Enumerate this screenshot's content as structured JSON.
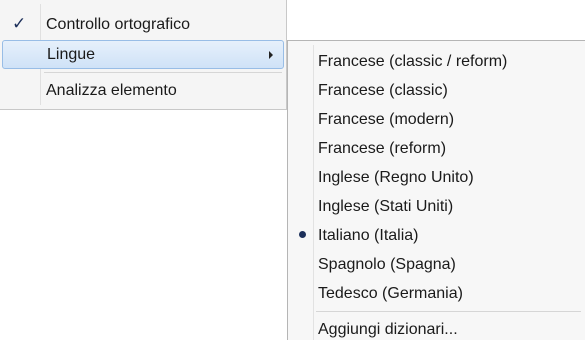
{
  "main_menu": {
    "items": [
      {
        "label": "Controllo ortografico",
        "checked": true
      },
      {
        "label": "Lingue",
        "has_submenu": true,
        "highlighted": true
      },
      {
        "label": "Analizza elemento"
      }
    ]
  },
  "languages_submenu": {
    "items": [
      {
        "label": "Francese (classic / reform)"
      },
      {
        "label": "Francese (classic)"
      },
      {
        "label": "Francese (modern)"
      },
      {
        "label": "Francese (reform)"
      },
      {
        "label": "Inglese (Regno Unito)"
      },
      {
        "label": "Inglese (Stati Uniti)"
      },
      {
        "label": "Italiano (Italia)",
        "selected": true
      },
      {
        "label": "Spagnolo (Spagna)"
      },
      {
        "label": "Tedesco (Germania)"
      }
    ],
    "add_dictionaries": "Aggiungi dizionari..."
  },
  "icons": {
    "check": "check-icon",
    "submenu_arrow": "chevron-right-icon",
    "selected": "radio-bullet-icon"
  },
  "colors": {
    "highlight_border": "#98bde6",
    "highlight_fill": "#d9e8f8",
    "menu_background": "#f7f7f7"
  }
}
